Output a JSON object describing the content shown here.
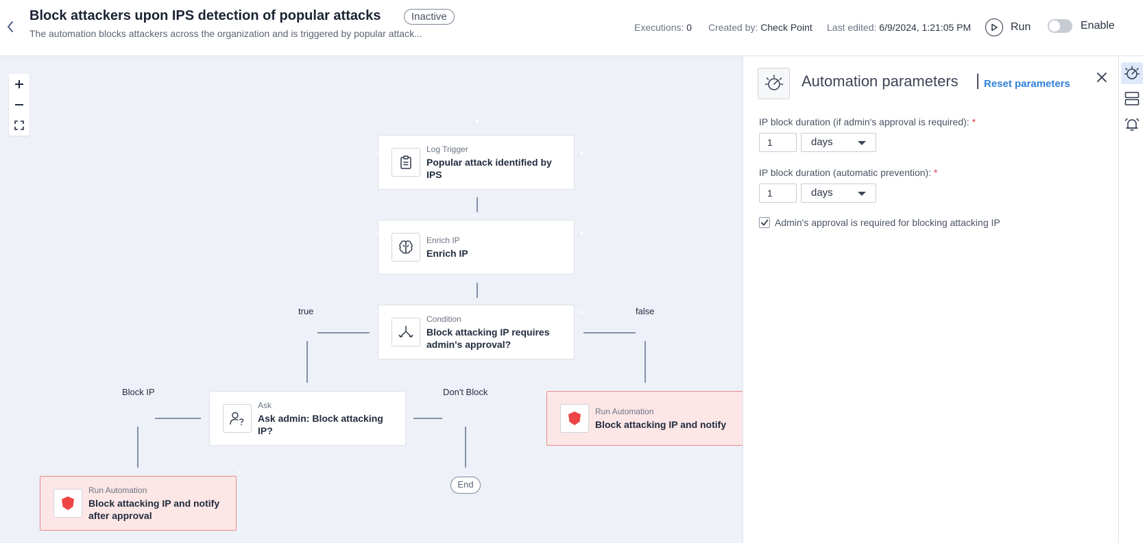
{
  "header": {
    "title": "Block attackers upon IPS detection of popular attacks",
    "status": "Inactive",
    "subtitle": "The automation blocks attackers across the organization and is triggered by popular attack...",
    "executions_label": "Executions:",
    "executions_value": "0",
    "created_by_label": "Created by:",
    "created_by_value": "Check Point",
    "last_edited_label": "Last edited:",
    "last_edited_value": "6/9/2024, 1:21:05 PM",
    "run_label": "Run",
    "enable_label": "Enable",
    "enabled": false
  },
  "canvas": {
    "zoom_in": "+",
    "zoom_out": "−",
    "nodes": {
      "trigger": {
        "type": "Log Trigger",
        "name": "Popular attack identified by IPS",
        "icon": "clipboard-icon"
      },
      "enrich": {
        "type": "Enrich IP",
        "name": "Enrich IP",
        "icon": "brain-icon"
      },
      "condition": {
        "type": "Condition",
        "name": "Block attacking IP requires admin's approval?",
        "icon": "split-icon"
      },
      "ask": {
        "type": "Ask",
        "name": "Ask admin: Block attacking IP?",
        "icon": "user-question-icon"
      },
      "run_notify": {
        "type": "Run Automation",
        "name": "Block attacking IP and notify",
        "icon": "shield-icon"
      },
      "run_after_approval": {
        "type": "Run Automation",
        "name": "Block attacking IP and notify after approval",
        "icon": "shield-icon"
      }
    },
    "edge_labels": {
      "true": "true",
      "false": "false",
      "block_ip": "Block IP",
      "dont_block": "Don't Block"
    },
    "end_label": "End"
  },
  "panel": {
    "title": "Automation parameters",
    "separator": "|",
    "reset_label": "Reset parameters",
    "field1_label": "IP block duration (if admin's approval is required):",
    "field1_value": "1",
    "field1_unit": "days",
    "field2_label": "IP block duration (automatic prevention):",
    "field2_value": "1",
    "field2_unit": "days",
    "required_mark": "*",
    "checkbox_label": "Admin's approval is required for blocking attacking IP",
    "checkbox_checked": true
  },
  "colors": {
    "accent": "#2f80d9",
    "danger_fill": "#fde6e6",
    "danger_border": "#e88a8a",
    "shield": "#ee4445",
    "canvas_bg": "#eef1f8"
  }
}
